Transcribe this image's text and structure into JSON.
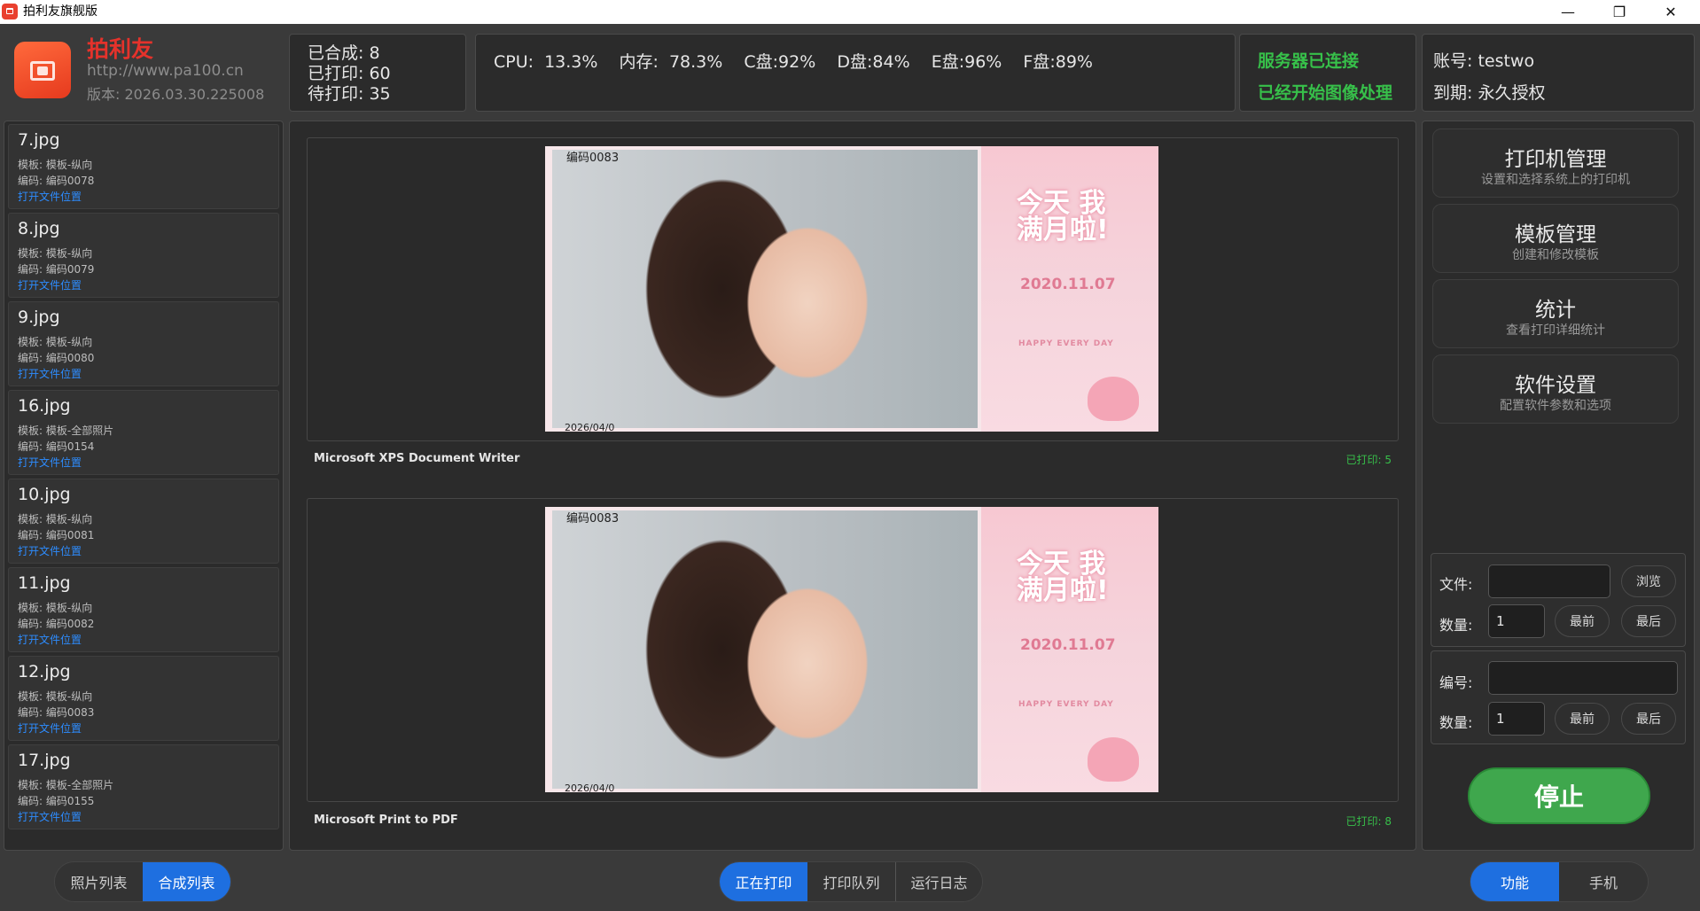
{
  "window": {
    "title": "拍利友旗舰版",
    "minimize_label": "—",
    "maximize_label": "❐",
    "close_label": "✕"
  },
  "brand": {
    "name": "拍利友",
    "url": "http://www.pa100.cn",
    "version": "版本: 2026.03.30.225008"
  },
  "stats": {
    "composed": "已合成: 8",
    "printed": "已打印: 60",
    "pending": "待打印: 35"
  },
  "system": {
    "text": "CPU: 13.3%  内存: 78.3%  C盘:92%  D盘:84%  E盘:96%  F盘:89%"
  },
  "status": {
    "server": "服务器已连接",
    "processing": "已经开始图像处理"
  },
  "account": {
    "user": "账号: testwo",
    "expiry": "到期: 永久授权"
  },
  "files": [
    {
      "name": "7.jpg",
      "template": "模板: 模板-纵向",
      "code": "编码: 编码0078",
      "link": "打开文件位置"
    },
    {
      "name": "8.jpg",
      "template": "模板: 模板-纵向",
      "code": "编码: 编码0079",
      "link": "打开文件位置"
    },
    {
      "name": "9.jpg",
      "template": "模板: 模板-纵向",
      "code": "编码: 编码0080",
      "link": "打开文件位置"
    },
    {
      "name": "16.jpg",
      "template": "模板: 模板-全部照片",
      "code": "编码: 编码0154",
      "link": "打开文件位置"
    },
    {
      "name": "10.jpg",
      "template": "模板: 模板-纵向",
      "code": "编码: 编码0081",
      "link": "打开文件位置"
    },
    {
      "name": "11.jpg",
      "template": "模板: 模板-纵向",
      "code": "编码: 编码0082",
      "link": "打开文件位置"
    },
    {
      "name": "12.jpg",
      "template": "模板: 模板-纵向",
      "code": "编码: 编码0083",
      "link": "打开文件位置"
    },
    {
      "name": "17.jpg",
      "template": "模板: 模板-全部照片",
      "code": "编码: 编码0155",
      "link": "打开文件位置"
    }
  ],
  "printers": [
    {
      "name": "Microsoft XPS Document Writer",
      "printed": "已打印: 5",
      "code_tag": "编码0083",
      "date_tag": "2026/04/0",
      "card_title": "今天 我满月啦!",
      "card_date": "2020.11.07",
      "card_happy": "HAPPY EVERY DAY"
    },
    {
      "name": "Microsoft Print to PDF",
      "printed": "已打印: 8",
      "code_tag": "编码0083",
      "date_tag": "2026/04/0",
      "card_title": "今天 我满月啦!",
      "card_date": "2020.11.07",
      "card_happy": "HAPPY EVERY DAY"
    }
  ],
  "menu": [
    {
      "title": "打印机管理",
      "subtitle": "设置和选择系统上的打印机"
    },
    {
      "title": "模板管理",
      "subtitle": "创建和修改模板"
    },
    {
      "title": "统计",
      "subtitle": "查看打印详细统计"
    },
    {
      "title": "软件设置",
      "subtitle": "配置软件参数和选项"
    }
  ],
  "form_file": {
    "file_label": "文件:",
    "file_value": "",
    "browse_label": "浏览",
    "qty_label": "数量:",
    "qty_value": "1",
    "first_label": "最前",
    "last_label": "最后"
  },
  "form_code": {
    "code_label": "编号:",
    "code_value": "",
    "qty_label": "数量:",
    "qty_value": "1",
    "first_label": "最前",
    "last_label": "最后"
  },
  "stop_label": "停止",
  "bottom_left_tabs": [
    "照片列表",
    "合成列表"
  ],
  "bottom_center_tabs": [
    "正在打印",
    "打印队列",
    "运行日志"
  ],
  "bottom_right_tabs": [
    "功能",
    "手机"
  ],
  "colors": {
    "accent_blue": "#1e6fe0",
    "status_green": "#37c04a",
    "brand_red": "#e5322b",
    "stop_green": "#3fa74d"
  }
}
